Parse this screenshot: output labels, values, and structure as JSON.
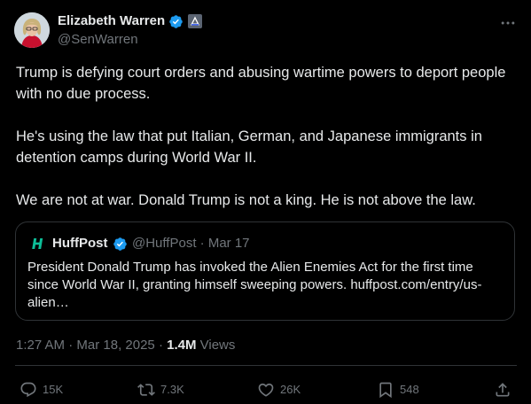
{
  "author": {
    "name": "Elizabeth Warren",
    "handle": "@SenWarren"
  },
  "tweet": {
    "paragraphs": [
      "Trump is defying court orders and abusing wartime powers to deport people with no due process.",
      "He's using the law that put Italian, German, and Japanese immigrants in detention camps during World War II.",
      "We are not at war. Donald Trump is not a king. He is not above the law."
    ]
  },
  "quote": {
    "name": "HuffPost",
    "handle": "@HuffPost",
    "separator": "·",
    "date": "Mar 17",
    "text": "President Donald Trump has invoked the Alien Enemies Act for the first time since World War II, granting himself sweeping powers. huffpost.com/entry/us-alien…"
  },
  "meta": {
    "time": "1:27 AM",
    "dot1": " · ",
    "date": "Mar 18, 2025",
    "dot2": " · ",
    "views": "1.4M",
    "views_label": " Views"
  },
  "actions": {
    "replies": "15K",
    "retweets": "7.3K",
    "likes": "26K",
    "bookmarks": "548"
  },
  "icons": {
    "verified": "verified-check-icon",
    "government": "government-badge-icon",
    "more": "more-horizontal-icon",
    "reply": "reply-icon",
    "retweet": "retweet-icon",
    "like": "heart-icon",
    "bookmark": "bookmark-icon",
    "share": "share-icon"
  },
  "colors": {
    "background": "#000000",
    "text": "#e7e9ea",
    "secondary": "#71767b",
    "border": "#2f3336",
    "verified": "#1d9bf0",
    "huffpost": "#0dbe98"
  }
}
